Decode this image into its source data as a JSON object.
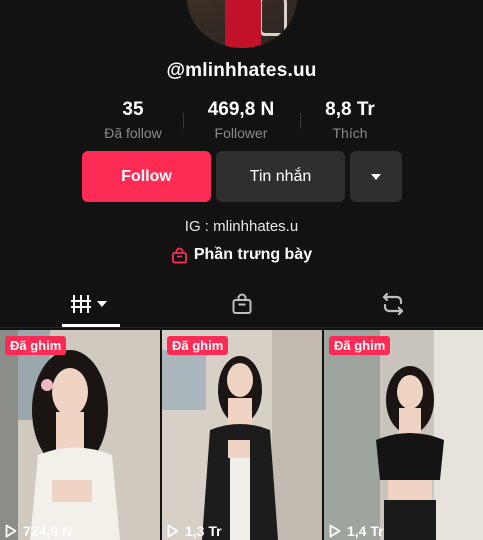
{
  "profile": {
    "username": "@mlinhhates.uu",
    "bio_line": "IG : mlinhhates.u",
    "showcase_label": "Phần trưng bày"
  },
  "stats": [
    {
      "value": "35",
      "label": "Đã follow"
    },
    {
      "value": "469,8 N",
      "label": "Follower"
    },
    {
      "value": "8,8 Tr",
      "label": "Thích"
    }
  ],
  "actions": {
    "follow_label": "Follow",
    "message_label": "Tin nhắn",
    "more_icon": "caret-down-icon"
  },
  "tabs": [
    {
      "icon": "grid-videos-icon",
      "active": true
    },
    {
      "icon": "shopping-bag-icon",
      "active": false
    },
    {
      "icon": "repost-icon",
      "active": false
    }
  ],
  "videos": [
    {
      "badge": "Đã ghim",
      "views": "724,9 N"
    },
    {
      "badge": "Đã ghim",
      "views": "1,3 Tr"
    },
    {
      "badge": "Đã ghim",
      "views": "1,4 Tr"
    }
  ],
  "colors": {
    "background": "#121212",
    "accent": "#fe2c55",
    "secondary_button": "#2f2f2f",
    "muted_text": "#8a8a8a"
  }
}
